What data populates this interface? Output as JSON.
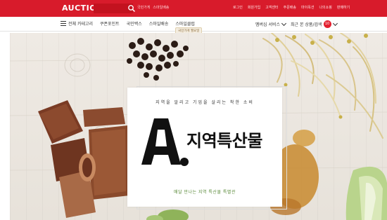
{
  "header": {
    "logo": "AUCTION.",
    "search_keywords": [
      "국민가게",
      "스마일배송"
    ],
    "links": [
      "로그인",
      "회원가입",
      "고객센터",
      "주문배송",
      "마이옥션",
      "나의쇼핑",
      "판매하기"
    ],
    "colors": {
      "brand_red": "#d81b2b"
    }
  },
  "nav": {
    "menu_label": "전체 카테고리",
    "items": [
      "쿠폰포인트",
      "국민백스",
      "스마일배송",
      "스마일클럽"
    ],
    "new_badge": "국민가게 월요일",
    "right_menu_label": "멤버십 서비스",
    "recent_label": "최근 본 상품/검색",
    "recent_count": "10"
  },
  "hero": {
    "tagline": "지역을 알리고 기업을 살리는 착한 소비",
    "mark": "A.",
    "title": "지역특산물",
    "subtitle": "매달 만나는 지역 특산물 특별관"
  }
}
